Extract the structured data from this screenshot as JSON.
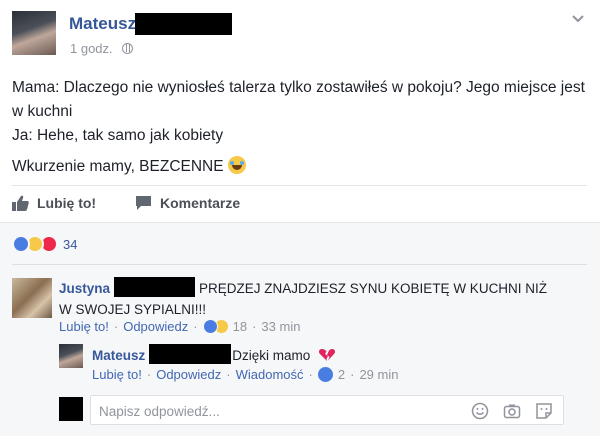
{
  "post": {
    "author": "Mateusz",
    "time": "1 godz.",
    "privacy_icon": "globe-icon",
    "lines": [
      "Mama: Dlaczego nie wyniosłeś talerza tylko zostawiłeś w pokoju? Jego miejsce jest w kuchni",
      "Ja: Hehe, tak samo jak kobiety",
      "Wkurzenie mamy, BEZCENNE"
    ],
    "actions": {
      "like_label": "Lubię to!",
      "comment_label": "Komentarze"
    }
  },
  "reactions": {
    "types": [
      "like",
      "haha",
      "love"
    ],
    "count": "34",
    "colors": {
      "like": "#4a7de2",
      "haha": "#f7c948",
      "love": "#f0284a"
    }
  },
  "comments": [
    {
      "author": "Justyna",
      "text": "PRĘDZEJ ZNAJDZIESZ SYNU KOBIETĘ W KUCHNI NIŻ W SWOJEJ SYPIALNI!!!",
      "like_label": "Lubię to!",
      "reply_label": "Odpowiedz",
      "reaction_count": "18",
      "time": "33 min"
    },
    {
      "author": "Mateusz",
      "text": "Dzięki mamo",
      "like_label": "Lubię to!",
      "reply_label": "Odpowiedz",
      "message_label": "Wiadomość",
      "reaction_count": "2",
      "time": "29 min"
    }
  ],
  "reply": {
    "placeholder": "Napisz odpowiedź..."
  },
  "theme": {
    "link_color": "#365899",
    "meta_color": "#90949c",
    "comment_bg": "#f6f7f9"
  }
}
